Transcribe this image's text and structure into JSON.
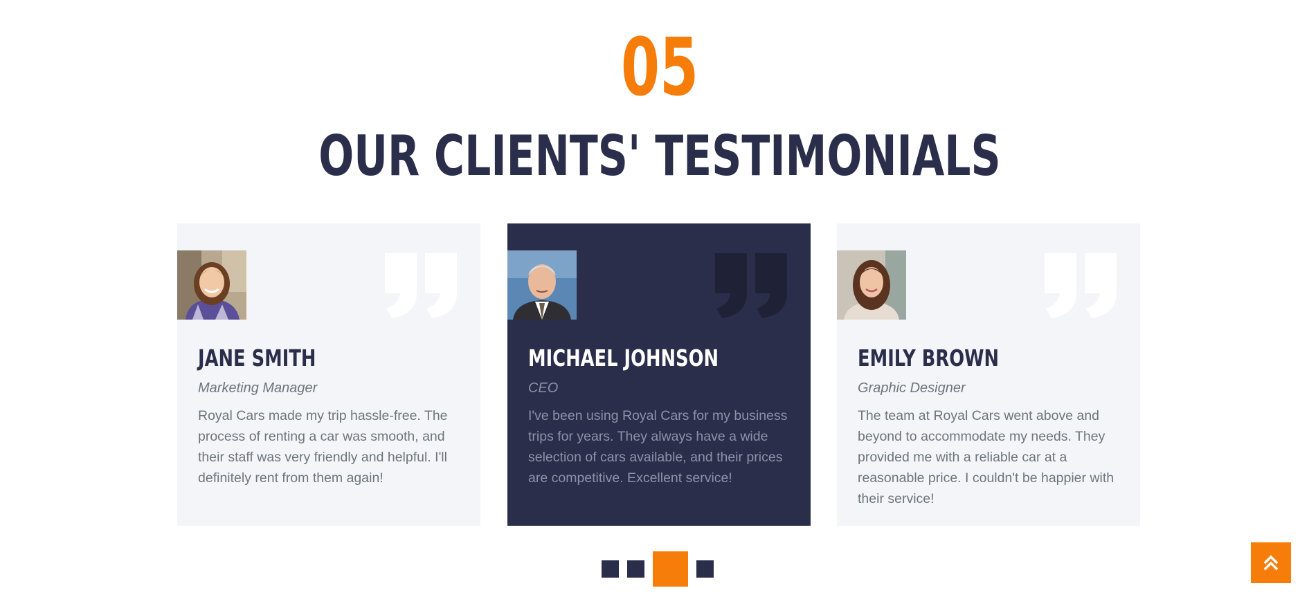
{
  "section": {
    "number": "05",
    "title": "OUR CLIENTS' TESTIMONIALS"
  },
  "testimonials": [
    {
      "name": "JANE SMITH",
      "role": "Marketing Manager",
      "text": "Royal Cars made my trip hassle-free. The process of renting a car was smooth, and their staff was very friendly and helpful. I'll definitely rent from them again!"
    },
    {
      "name": "MICHAEL JOHNSON",
      "role": "CEO",
      "text": "I've been using Royal Cars for my business trips for years. They always have a wide selection of cars available, and their prices are competitive. Excellent service!"
    },
    {
      "name": "EMILY BROWN",
      "role": "Graphic Designer",
      "text": "The team at Royal Cars went above and beyond to accommodate my needs. They provided me with a reliable car at a reasonable price. I couldn't be happier with their service!"
    }
  ],
  "carousel": {
    "dot_count": 4,
    "active_dot": 3
  },
  "colors": {
    "accent": "#f77d0a",
    "dark": "#2b2e4a",
    "light_card": "#f4f5f8",
    "body_text": "#6c757d"
  },
  "icons": {
    "quote": "quote-right-icon",
    "back_to_top": "double-chevron-up-icon"
  }
}
